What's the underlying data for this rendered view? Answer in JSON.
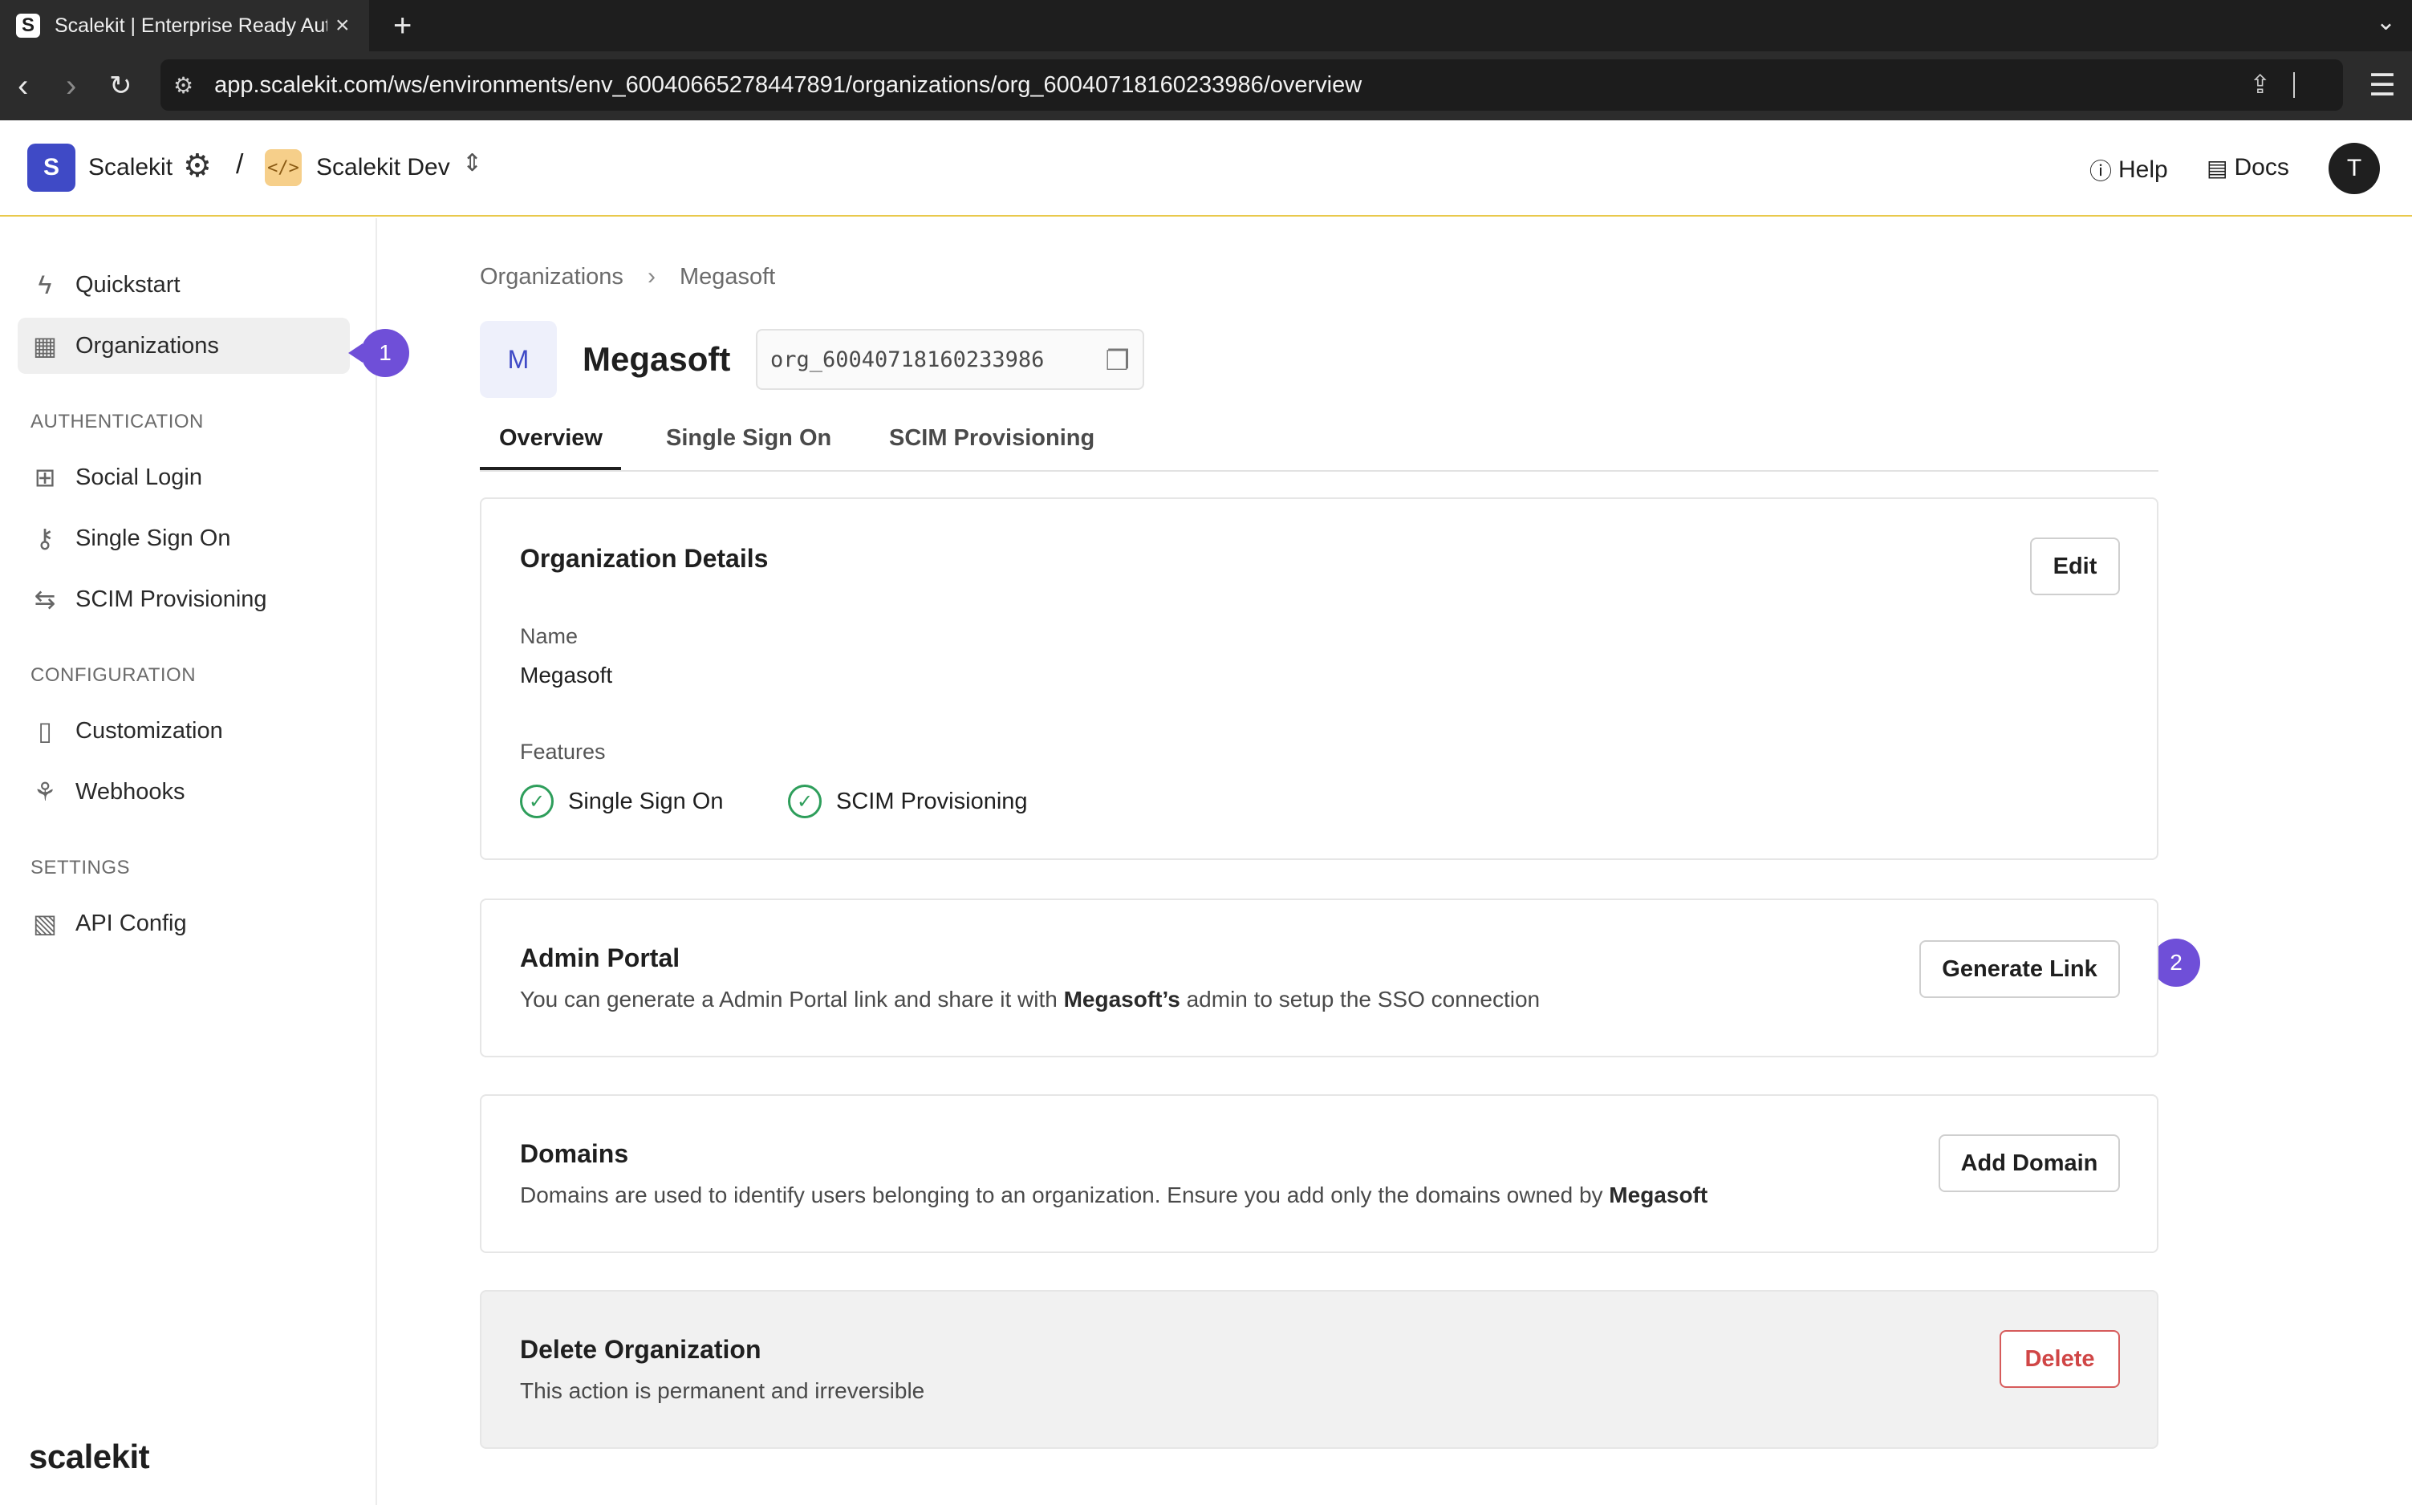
{
  "browser": {
    "tab_title": "Scalekit | Enterprise Ready Auth",
    "favicon_letter": "S",
    "url": "app.scalekit.com/ws/environments/env_60040665278447891/organizations/org_60040718160233986/overview"
  },
  "header": {
    "workspace_initial": "S",
    "workspace_name": "Scalekit",
    "separator": "/",
    "environment_icon": "</>",
    "environment_name": "Scalekit Dev",
    "help_label": "Help",
    "docs_label": "Docs",
    "avatar_initial": "T"
  },
  "sidebar": {
    "items": [
      {
        "label": "Quickstart",
        "icon": "bolt-icon"
      },
      {
        "label": "Organizations",
        "icon": "building-icon"
      }
    ],
    "sections": [
      {
        "title": "AUTHENTICATION",
        "items": [
          {
            "label": "Social Login",
            "icon": "grid-icon"
          },
          {
            "label": "Single Sign On",
            "icon": "key-icon"
          },
          {
            "label": "SCIM Provisioning",
            "icon": "arrows-swap-icon"
          }
        ]
      },
      {
        "title": "CONFIGURATION",
        "items": [
          {
            "label": "Customization",
            "icon": "mouse-icon"
          },
          {
            "label": "Webhooks",
            "icon": "webhook-icon"
          }
        ]
      },
      {
        "title": "SETTINGS",
        "items": [
          {
            "label": "API Config",
            "icon": "file-code-icon"
          }
        ]
      }
    ],
    "logo_text": "scalekit"
  },
  "step_badges": [
    "1",
    "2"
  ],
  "breadcrumb": [
    "Organizations",
    "Megasoft"
  ],
  "org": {
    "initial": "M",
    "name": "Megasoft",
    "id": "org_60040718160233986"
  },
  "tabs": [
    "Overview",
    "Single Sign On",
    "SCIM Provisioning"
  ],
  "details": {
    "title": "Organization Details",
    "edit_label": "Edit",
    "name_label": "Name",
    "name_value": "Megasoft",
    "features_label": "Features",
    "features": [
      "Single Sign On",
      "SCIM Provisioning"
    ]
  },
  "admin_portal": {
    "title": "Admin Portal",
    "desc_pre": "You can generate a Admin Portal link and share it with ",
    "desc_bold": "Megasoft’s",
    "desc_post": " admin to setup the SSO connection",
    "button": "Generate Link"
  },
  "domains": {
    "title": "Domains",
    "desc_pre": "Domains are used to identify users belonging to an organization. Ensure you add only the domains owned by ",
    "desc_bold": "Megasoft",
    "button": "Add Domain"
  },
  "delete_org": {
    "title": "Delete Organization",
    "desc": "This action is permanent and irreversible",
    "button": "Delete"
  },
  "colors": {
    "accent": "#6f4fd8",
    "brand": "#3f4ac6",
    "success": "#2e9e5b",
    "danger": "#d04646",
    "header_border": "#e9c94d"
  }
}
